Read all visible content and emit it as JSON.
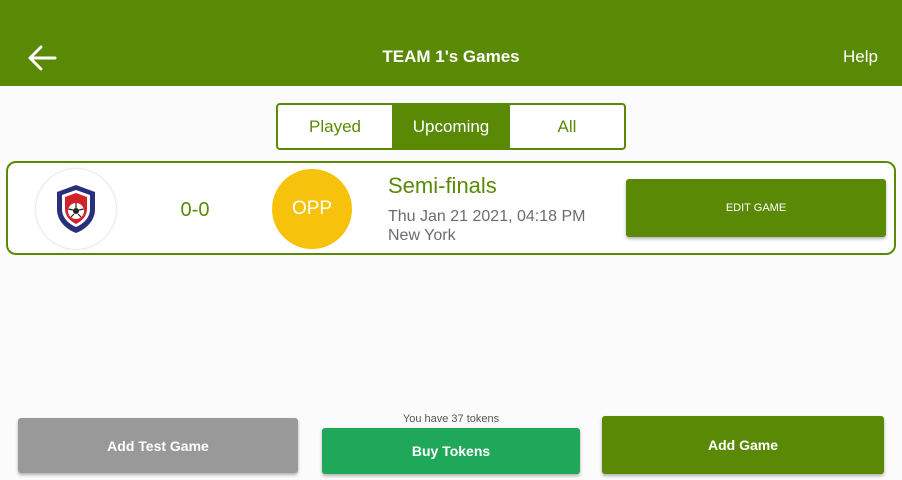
{
  "header": {
    "title": "TEAM 1's Games",
    "help_label": "Help",
    "back_icon": "arrow-left-icon"
  },
  "tabs": [
    {
      "label": "Played",
      "active": false
    },
    {
      "label": "Upcoming",
      "active": true
    },
    {
      "label": "All",
      "active": false
    }
  ],
  "game": {
    "team_logo_icon": "shield-soccer-ball-icon",
    "score": "0-0",
    "opponent": "OPP",
    "stage": "Semi-finals",
    "datetime": "Thu Jan 21 2021, 04:18 PM",
    "location": "New York",
    "edit_label": "EDIT GAME"
  },
  "footer": {
    "tokens_text": "You have 37 tokens",
    "add_test_label": "Add Test Game",
    "buy_tokens_label": "Buy Tokens",
    "add_game_label": "Add Game"
  },
  "colors": {
    "primary": "#5a8a05",
    "opponent_badge": "#f7c20c",
    "buy_tokens": "#20a85a",
    "disabled": "#999999"
  }
}
